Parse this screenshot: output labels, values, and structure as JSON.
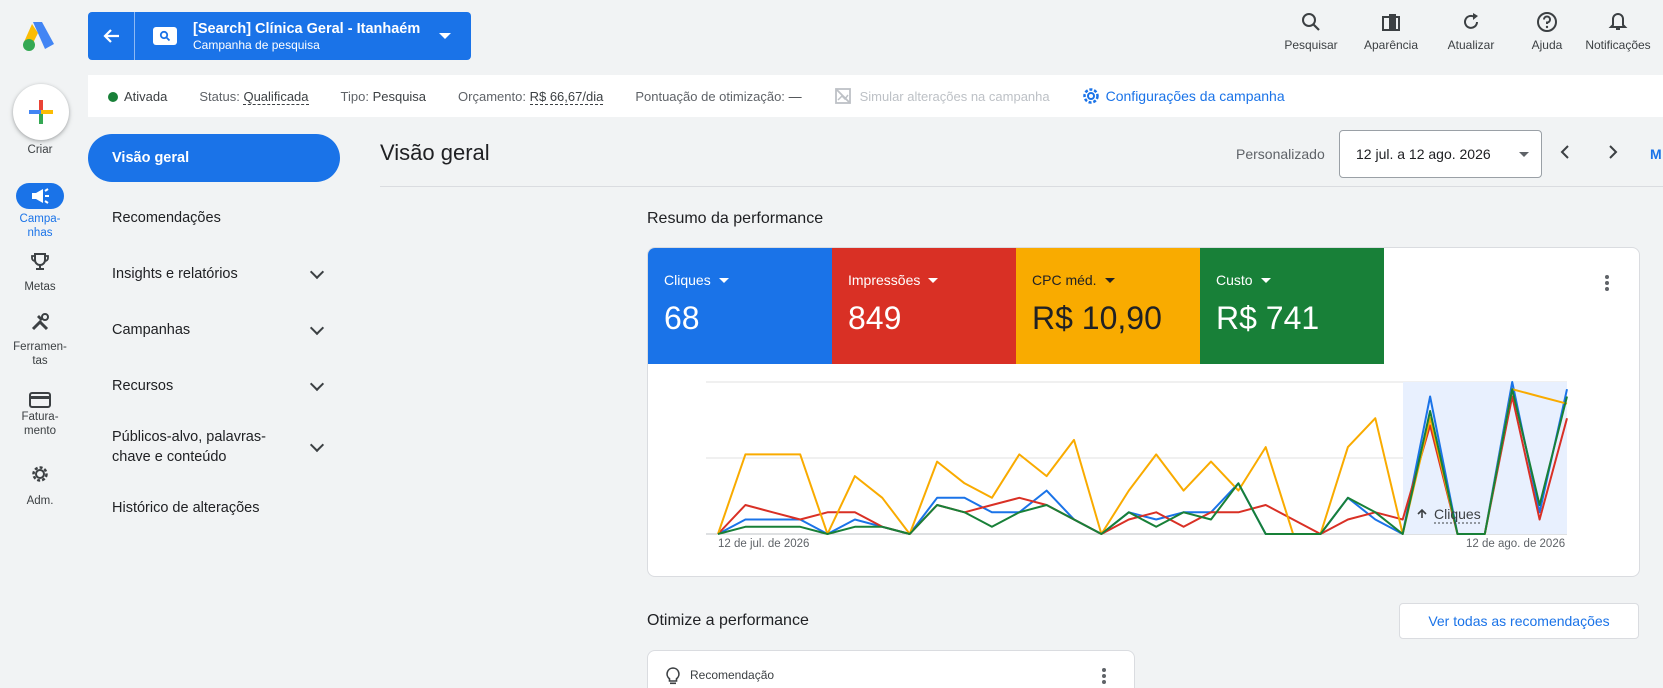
{
  "rail": {
    "create": "Criar",
    "items": [
      {
        "label": "Campa-\nnhas",
        "icon": "campaigns-icon"
      },
      {
        "label": "Metas",
        "icon": "trophy-icon"
      },
      {
        "label": "Ferramen-\ntas",
        "icon": "tools-icon"
      },
      {
        "label": "Fatura-\nmento",
        "icon": "credit-card-icon"
      },
      {
        "label": "Adm.",
        "icon": "gear-icon"
      }
    ]
  },
  "header": {
    "campaign_title": "[Search] Clínica Geral - Itanhaém",
    "campaign_subtitle": "Campanha de pesquisa",
    "tools": [
      {
        "label": "Pesquisar",
        "icon": "search-icon"
      },
      {
        "label": "Aparência",
        "icon": "appearance-icon"
      },
      {
        "label": "Atualizar",
        "icon": "refresh-icon"
      },
      {
        "label": "Ajuda",
        "icon": "help-icon"
      },
      {
        "label": "Notificações",
        "icon": "bell-icon"
      }
    ]
  },
  "status_bar": {
    "enabled": "Ativada",
    "status_label": "Status:",
    "status_value": "Qualificada",
    "type_label": "Tipo:",
    "type_value": "Pesquisa",
    "budget_label": "Orçamento:",
    "budget_value": "R$ 66,67/dia",
    "optimization_label": "Pontuação de otimização:",
    "optimization_value": "—",
    "simulate": "Simular alterações na campanha",
    "settings": "Configurações da campanha"
  },
  "nav": {
    "items": [
      "Visão geral",
      "Recomendações",
      "Insights e relatórios",
      "Campanhas",
      "Recursos",
      "Públicos-alvo, palavras-chave e conteúdo",
      "Histórico de alterações"
    ],
    "line_1": "Públicos-alvo, palavras-",
    "line_2": "chave e conteúdo"
  },
  "main": {
    "title": "Visão geral",
    "date_mode": "Personalizado",
    "date_range": "12 jul. a 12 ago. 2026",
    "cut_text": "M",
    "perf_title": "Resumo da performance",
    "optimize_title": "Otimize a performance",
    "see_all": "Ver todas as recomendações",
    "reco_label": "Recomendação"
  },
  "metrics": [
    {
      "label": "Cliques",
      "value": "68",
      "color": "#1a73e8"
    },
    {
      "label": "Impressões",
      "value": "849",
      "color": "#d93025"
    },
    {
      "label": "CPC méd.",
      "value": "R$ 10,90",
      "color": "#f9ab00"
    },
    {
      "label": "Custo",
      "value": "R$ 741",
      "color": "#188038"
    }
  ],
  "chart_data": {
    "type": "line",
    "x_start_label": "12 de jul. de 2026",
    "x_end_label": "12 de ago. de 2026",
    "tooltip_label": "Cliques",
    "series": [
      {
        "name": "Cliques",
        "color": "#1a73e8",
        "values": [
          0,
          2,
          2,
          2,
          0,
          2,
          1,
          0,
          5,
          5,
          3,
          3,
          6,
          2,
          0,
          3,
          2,
          3,
          3,
          7,
          0,
          0,
          0,
          5,
          2,
          0,
          19,
          0,
          0,
          21,
          3,
          20
        ]
      },
      {
        "name": "Impressões",
        "color": "#d93025",
        "values": [
          0,
          4,
          3,
          2,
          3,
          3,
          1,
          0,
          4,
          3,
          4,
          5,
          4,
          2,
          0,
          2,
          3,
          1,
          3,
          3,
          4,
          2,
          0,
          2,
          3,
          2,
          15,
          0,
          0,
          19,
          2,
          16
        ]
      },
      {
        "name": "CPC méd.",
        "color": "#f9ab00",
        "values": [
          0,
          11,
          11,
          11,
          0,
          8,
          5,
          0,
          10,
          7,
          5,
          11,
          8,
          13,
          0,
          6,
          11,
          6,
          10,
          6,
          12,
          0,
          0,
          12,
          16,
          0,
          16,
          0,
          0,
          20,
          19,
          18
        ]
      },
      {
        "name": "Custo",
        "color": "#188038",
        "values": [
          0,
          1,
          1,
          1,
          0,
          1,
          1,
          0,
          4,
          3,
          1,
          3,
          4,
          2,
          0,
          3,
          1,
          3,
          2,
          7,
          0,
          0,
          0,
          5,
          3,
          0,
          17,
          0,
          0,
          20,
          4,
          19
        ]
      }
    ]
  }
}
